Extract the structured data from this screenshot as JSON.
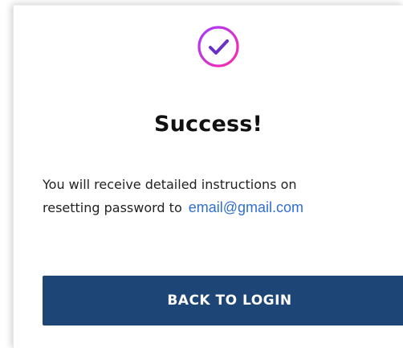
{
  "dialog": {
    "icon": "check-circle-icon",
    "title": "Success!",
    "message_line1": "You will receive detailed instructions on",
    "message_line2": "resetting password to",
    "email": "email@gmail.com",
    "back_button_label": "BACK TO LOGIN"
  },
  "colors": {
    "button_bg": "#1d4576",
    "email_link": "#2f6fd1",
    "icon_gradient_start": "#a33cff",
    "icon_gradient_end": "#ff2aa6"
  }
}
